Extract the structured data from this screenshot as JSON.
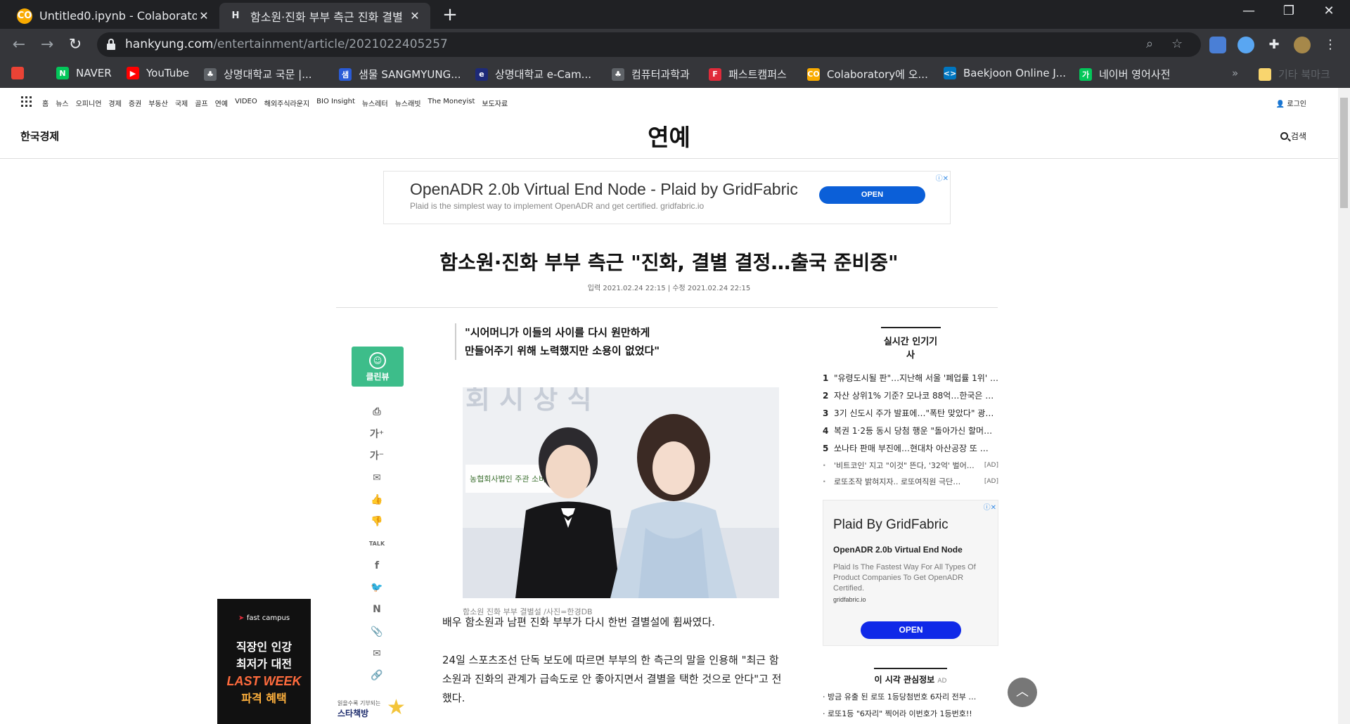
{
  "browser": {
    "tabs": [
      {
        "title": "Untitled0.ipynb - Colaboratory",
        "active": false
      },
      {
        "title": "함소원·진화 부부 측근 진화 결별",
        "active": true
      }
    ],
    "new_tab_symbol": "+",
    "tab_close_symbol": "✕",
    "window_controls": {
      "minimize": "—",
      "restore": "❐",
      "close": "✕"
    },
    "url_host": "hankyung.com",
    "url_path": "/entertainment/article/2021022405257",
    "bookmarks": [
      {
        "label": "",
        "icon": "apps-grid-icon",
        "color": "#ea4335"
      },
      {
        "label": "NAVER",
        "icon": "naver-icon",
        "color": "#03c75a"
      },
      {
        "label": "YouTube",
        "icon": "youtube-icon",
        "color": "#ff0000"
      },
      {
        "label": "상명대학교 국문 |...",
        "icon": "smu-icon",
        "color": "#9aa0a6"
      },
      {
        "label": "샘물 SANGMYUNG...",
        "icon": "saemmul-icon",
        "color": "#2a5bd7"
      },
      {
        "label": "상명대학교 e-Cam...",
        "icon": "ecampus-icon",
        "color": "#1e2a78"
      },
      {
        "label": "컴퓨터과학과",
        "icon": "cs-icon",
        "color": "#9aa0a6"
      },
      {
        "label": "패스트캠퍼스",
        "icon": "fastcampus-icon",
        "color": "#e02b3a"
      },
      {
        "label": "Colaboratory에 오...",
        "icon": "colab-icon",
        "color": "#f9ab00"
      },
      {
        "label": "Baekjoon Online J...",
        "icon": "baekjoon-icon",
        "color": "#0076c0"
      },
      {
        "label": "네이버 영어사전",
        "icon": "naver-dict-icon",
        "color": "#03c75a"
      }
    ],
    "bookmarks_overflow": "»",
    "other_bookmarks": "기타 북마크"
  },
  "site": {
    "nav_links": [
      "홈",
      "뉴스",
      "오피니언",
      "경제",
      "증권",
      "부동산",
      "국제",
      "골프",
      "연예",
      "VIDEO",
      "해외주식라운지",
      "BIO Insight",
      "뉴스레터",
      "뉴스래빗",
      "The Moneyist",
      "보도자료"
    ],
    "login": "로그인",
    "logo": "한국경제",
    "section": "연예",
    "search": "검색"
  },
  "ad_top": {
    "headline": "OpenADR 2.0b Virtual End Node - Plaid by GridFabric",
    "sub": "Plaid is the simplest way to implement OpenADR and get certified. gridfabric.io",
    "button": "OPEN",
    "adchoices": "ⓘ✕"
  },
  "article": {
    "title": "함소원·진화 부부 측근 \"진화, 결별 결정…출국 준비중\"",
    "dates": "입력 2021.02.24 22:15 | 수정 2021.02.24 22:15",
    "quote_line1": "\"시어머니가 이들의 사이를 다시 원만하게",
    "quote_line2": "만들어주기 위해 노력했지만 소용이 없었다\"",
    "photo_backdrop_text": "농협회사법인 주관 소비자평가",
    "caption": "함소원 진화 부부 결별설 /사진=한경DB",
    "para1": "배우 함소원과 남편 진화 부부가 다시 한번 결별설에 휩싸였다.",
    "para2": "24일 스포츠조선 단독 보도에 따르면 부부의 한 측근의 말을 인용해 \"최근 함소원과 진화의 관계가 급속도로 안 좋아지면서 결별을 택한 것으로 안다\"고 전했다."
  },
  "toolbar_side": {
    "cleanview": "클린뷰",
    "icons": [
      {
        "name": "print-icon",
        "glyph": "⎙"
      },
      {
        "name": "font-increase-icon",
        "glyph": "가⁺"
      },
      {
        "name": "font-decrease-icon",
        "glyph": "가⁻"
      },
      {
        "name": "comment-icon",
        "glyph": "✉"
      },
      {
        "name": "like-icon",
        "glyph": "👍"
      },
      {
        "name": "dislike-icon",
        "glyph": "👎"
      },
      {
        "name": "kakaotalk-icon",
        "glyph": "TALK"
      },
      {
        "name": "facebook-icon",
        "glyph": "f"
      },
      {
        "name": "twitter-icon",
        "glyph": "🐦"
      },
      {
        "name": "naver-share-icon",
        "glyph": "N"
      },
      {
        "name": "clip-icon",
        "glyph": "📎"
      },
      {
        "name": "email-icon",
        "glyph": "✉"
      },
      {
        "name": "link-icon",
        "glyph": "🔗"
      }
    ]
  },
  "popular": {
    "title": "실시간 인기기사",
    "items": [
      {
        "num": "1",
        "text": "\"유령도시될 판\"…지난해 서울 '폐업률 1위' …"
      },
      {
        "num": "2",
        "text": "자산 상위1% 기준? 모나코 88억…한국은 …"
      },
      {
        "num": "3",
        "text": "3기 신도시 주가 발표에…\"폭탄 맞았다\" 광…"
      },
      {
        "num": "4",
        "text": "복권 1‧2등 동시 당첨 행운 \"돌아가신 할머…"
      },
      {
        "num": "5",
        "text": "쏘나타 판매 부진에…현대차 아산공장 또 …"
      }
    ],
    "ads": [
      {
        "text": "'비트코인' 지고 \"이것\" 뜬다, '32억' 벌어…",
        "tag": "[AD]"
      },
      {
        "text": "로또조작 밝혀지자.. 로또여직원 극단…",
        "tag": "[AD]"
      }
    ]
  },
  "ad_right": {
    "heading": "Plaid By GridFabric",
    "sub1": "OpenADR 2.0b Virtual End Node",
    "sub2": "Plaid Is The Fastest Way For All Types Of Product Companies To Get OpenADR Certified.",
    "domain": "gridfabric.io",
    "button": "OPEN",
    "adchoices": "ⓘ✕"
  },
  "interest": {
    "title": "이 시각 관심정보",
    "ad_tag": "AD",
    "items": [
      "· 방금 유출 된 로또 1등당첨번호 6자리 전부 …",
      "· 로또1등 \"6자리\" 찍어라 이번호가 1등번호!!"
    ]
  },
  "ad_left": {
    "brand": "fast campus",
    "line1": "직장인 인강",
    "line2": "최저가 대전",
    "line3": "LAST WEEK",
    "line4": "파격 혜택"
  },
  "ad_mini": {
    "line1": "읽을수록 기부되는",
    "line2": "스타책방"
  }
}
